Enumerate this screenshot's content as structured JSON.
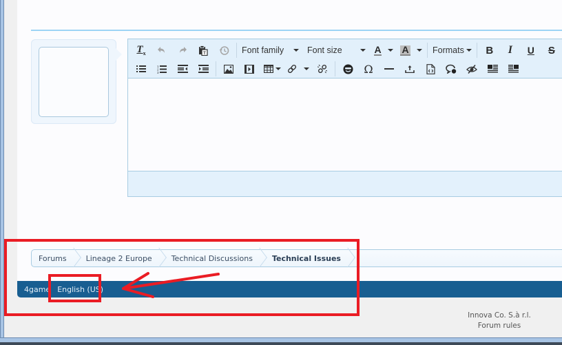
{
  "editor": {
    "toolbar_row1": [
      {
        "icon": "clear-formatting-icon",
        "glyph": "Tx"
      },
      {
        "icon": "undo-icon",
        "glyph": "↶",
        "disabled": true
      },
      {
        "icon": "redo-icon",
        "glyph": "↷",
        "disabled": true
      },
      {
        "icon": "paste-text-icon",
        "glyph": "📋"
      },
      {
        "icon": "restore-draft-icon",
        "glyph": "⟲",
        "disabled": true
      }
    ],
    "font_family_label": "Font family",
    "font_size_label": "Font size",
    "text_color_glyph": "A",
    "bg_color_glyph": "A",
    "formats_label": "Formats",
    "bold_glyph": "B",
    "italic_glyph": "I",
    "underline_glyph": "U",
    "strike_glyph": "S",
    "omega_glyph": "Ω"
  },
  "breadcrumb": {
    "items": [
      "Forums",
      "Lineage 2 Europe",
      "Technical Discussions",
      "Technical Issues"
    ]
  },
  "footer": {
    "links": [
      "4game",
      "English (US)"
    ],
    "copyright": "Innova Co. S.à r.l.",
    "rules": "Forum rules"
  },
  "colors": {
    "footer_bar": "#185e91",
    "annotation": "#ea1c24",
    "toolbar_bg": "#e2f0fb"
  }
}
